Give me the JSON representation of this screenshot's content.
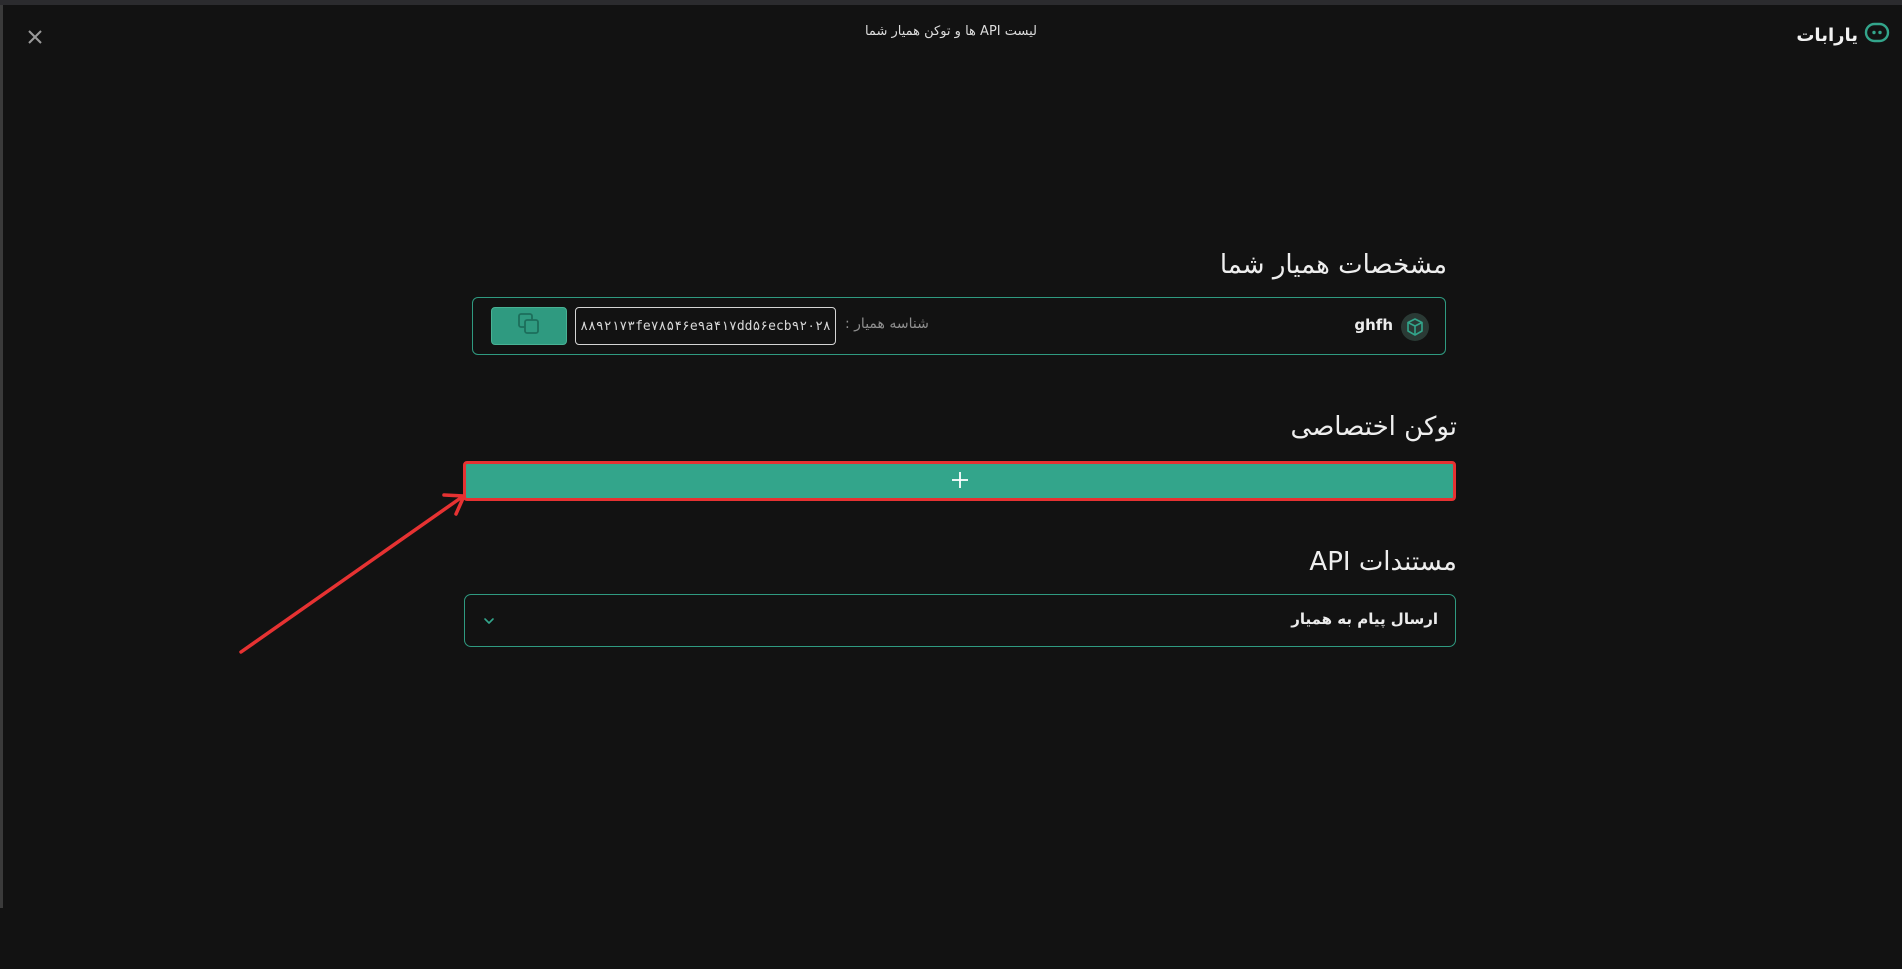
{
  "header": {
    "title": "لیست API ها و توکن همیار شما",
    "logo_text": "یارابات",
    "close_icon": "close-icon"
  },
  "assistant_spec": {
    "title": "مشخصات همیار شما",
    "name": "ghfh",
    "id_label": "شناسه همیار :",
    "id_value": "۸۸۹۲۱۷۳fe۷۸۵۴۶e۹a۴۱۷dd۵۶ecb۹۲۰۲۸",
    "copy_icon": "copy-icon",
    "bot_icon": "cube-icon"
  },
  "token": {
    "title": "توکن اختصاصی",
    "add_icon": "plus-icon"
  },
  "api_docs": {
    "title": "مستندات API",
    "items": [
      {
        "label": "ارسال پیام به همیار",
        "icon": "chevron-down-icon"
      }
    ]
  },
  "colors": {
    "background": "#121212",
    "accent": "#33a58b",
    "accent_border": "#2f9a80",
    "annotation_red": "#e63232"
  }
}
